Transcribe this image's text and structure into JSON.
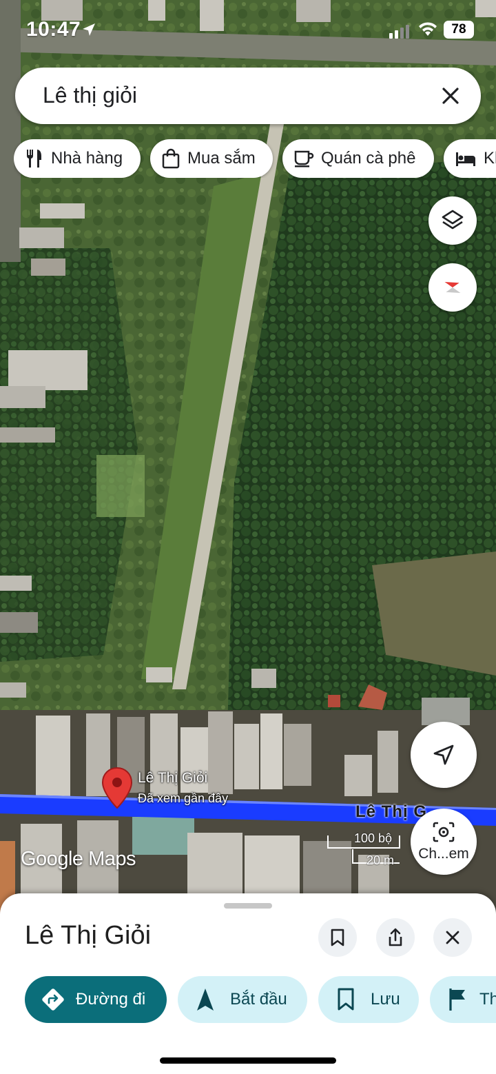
{
  "status_bar": {
    "time": "10:47",
    "battery": "78"
  },
  "search": {
    "query": "Lê thị giỏi"
  },
  "chips": [
    {
      "label": "Nhà hàng",
      "icon": "fork-knife-icon"
    },
    {
      "label": "Mua sắm",
      "icon": "shopping-bag-icon"
    },
    {
      "label": "Quán cà phê",
      "icon": "coffee-cup-icon"
    },
    {
      "label": "Kh",
      "icon": "bed-icon"
    }
  ],
  "map": {
    "pin": {
      "title": "Lê Thị Giỏi",
      "subtitle": "Đã xem gần đây"
    },
    "road_label": "Lê Thị G",
    "scale": {
      "imperial": "100 bộ",
      "metric": "20 m"
    },
    "logo": "Google Maps",
    "street_view_label": "Ch...em",
    "route_color": "#1a3cff",
    "pin_color": "#e53935"
  },
  "sheet": {
    "title": "Lê Thị Giỏi",
    "actions": [
      {
        "label": "Đường đi",
        "icon": "directions-icon"
      },
      {
        "label": "Bắt đầu",
        "icon": "navigation-arrow-icon"
      },
      {
        "label": "Lưu",
        "icon": "bookmark-icon"
      },
      {
        "label": "Th",
        "icon": "flag-icon"
      }
    ]
  },
  "colors": {
    "accent": "#0b6e7a",
    "accent_light": "#d3f1f7"
  }
}
